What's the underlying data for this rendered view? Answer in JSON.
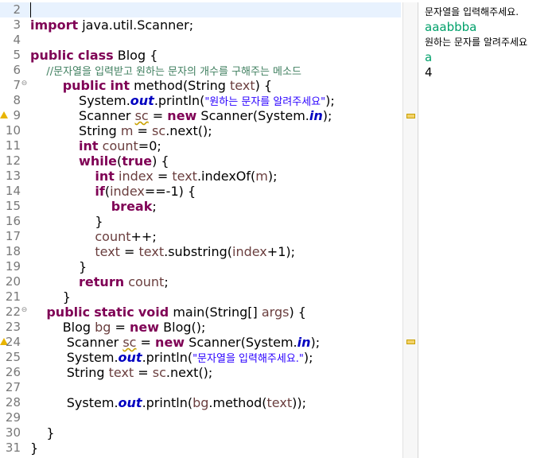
{
  "editor": {
    "lines": [
      {
        "n": "2",
        "parts": [],
        "current": true
      },
      {
        "n": "3",
        "parts": [
          [
            "kw",
            "import"
          ],
          [
            "t",
            " java.util.Scanner;"
          ]
        ]
      },
      {
        "n": "4",
        "parts": []
      },
      {
        "n": "5",
        "parts": [
          [
            "kw",
            "public"
          ],
          [
            "t",
            " "
          ],
          [
            "kw",
            "class"
          ],
          [
            "t",
            " Blog {"
          ]
        ]
      },
      {
        "n": "6",
        "parts": [
          [
            "t",
            "    "
          ],
          [
            "cm",
            "//문자열을 입력받고 원하는 문자의 개수를 구해주는 메소드"
          ]
        ]
      },
      {
        "n": "7",
        "fold": "⊖",
        "parts": [
          [
            "t",
            "        "
          ],
          [
            "kw",
            "public"
          ],
          [
            "t",
            " "
          ],
          [
            "kw",
            "int"
          ],
          [
            "t",
            " method(String "
          ],
          [
            "var",
            "text"
          ],
          [
            "t",
            ") {"
          ]
        ]
      },
      {
        "n": "8",
        "parts": [
          [
            "t",
            "            System."
          ],
          [
            "fld",
            "out"
          ],
          [
            "t",
            ".println("
          ],
          [
            "st",
            "\"원하는 문자를 알려주세요\""
          ],
          [
            "t",
            ");"
          ]
        ]
      },
      {
        "n": "9",
        "warn": true,
        "parts": [
          [
            "t",
            "            Scanner "
          ],
          [
            "varw",
            "sc"
          ],
          [
            "t",
            " = "
          ],
          [
            "kw",
            "new"
          ],
          [
            "t",
            " Scanner(System."
          ],
          [
            "fld",
            "in"
          ],
          [
            "t",
            ");"
          ]
        ]
      },
      {
        "n": "10",
        "parts": [
          [
            "t",
            "            String "
          ],
          [
            "var",
            "m"
          ],
          [
            "t",
            " = "
          ],
          [
            "var",
            "sc"
          ],
          [
            "t",
            ".next();"
          ]
        ]
      },
      {
        "n": "11",
        "parts": [
          [
            "t",
            "            "
          ],
          [
            "kw",
            "int"
          ],
          [
            "t",
            " "
          ],
          [
            "var",
            "count"
          ],
          [
            "t",
            "=0;"
          ]
        ]
      },
      {
        "n": "12",
        "parts": [
          [
            "t",
            "            "
          ],
          [
            "kw",
            "while"
          ],
          [
            "t",
            "("
          ],
          [
            "kw",
            "true"
          ],
          [
            "t",
            ") {"
          ]
        ]
      },
      {
        "n": "13",
        "parts": [
          [
            "t",
            "                "
          ],
          [
            "kw",
            "int"
          ],
          [
            "t",
            " "
          ],
          [
            "var",
            "index"
          ],
          [
            "t",
            " = "
          ],
          [
            "var",
            "text"
          ],
          [
            "t",
            ".indexOf("
          ],
          [
            "var",
            "m"
          ],
          [
            "t",
            ");"
          ]
        ]
      },
      {
        "n": "14",
        "parts": [
          [
            "t",
            "                "
          ],
          [
            "kw",
            "if"
          ],
          [
            "t",
            "("
          ],
          [
            "var",
            "index"
          ],
          [
            "t",
            "==-1) {"
          ]
        ]
      },
      {
        "n": "15",
        "parts": [
          [
            "t",
            "                    "
          ],
          [
            "kw",
            "break"
          ],
          [
            "t",
            ";"
          ]
        ]
      },
      {
        "n": "16",
        "parts": [
          [
            "t",
            "                }"
          ]
        ]
      },
      {
        "n": "17",
        "parts": [
          [
            "t",
            "                "
          ],
          [
            "var",
            "count"
          ],
          [
            "t",
            "++;"
          ]
        ]
      },
      {
        "n": "18",
        "parts": [
          [
            "t",
            "                "
          ],
          [
            "var",
            "text"
          ],
          [
            "t",
            " = "
          ],
          [
            "var",
            "text"
          ],
          [
            "t",
            ".substring("
          ],
          [
            "var",
            "index"
          ],
          [
            "t",
            "+1);"
          ]
        ]
      },
      {
        "n": "19",
        "parts": [
          [
            "t",
            "            }"
          ]
        ]
      },
      {
        "n": "20",
        "parts": [
          [
            "t",
            "            "
          ],
          [
            "kw",
            "return"
          ],
          [
            "t",
            " "
          ],
          [
            "var",
            "count"
          ],
          [
            "t",
            ";"
          ]
        ]
      },
      {
        "n": "21",
        "parts": [
          [
            "t",
            "        }"
          ]
        ]
      },
      {
        "n": "22",
        "fold": "⊖",
        "parts": [
          [
            "t",
            "    "
          ],
          [
            "kw",
            "public"
          ],
          [
            "t",
            " "
          ],
          [
            "kw",
            "static"
          ],
          [
            "t",
            " "
          ],
          [
            "kw",
            "void"
          ],
          [
            "t",
            " main(String[] "
          ],
          [
            "var",
            "args"
          ],
          [
            "t",
            ") {"
          ]
        ]
      },
      {
        "n": "23",
        "parts": [
          [
            "t",
            "        Blog "
          ],
          [
            "var",
            "bg"
          ],
          [
            "t",
            " = "
          ],
          [
            "kw",
            "new"
          ],
          [
            "t",
            " Blog();"
          ]
        ]
      },
      {
        "n": "24",
        "warn": true,
        "parts": [
          [
            "t",
            "         Scanner "
          ],
          [
            "varw",
            "sc"
          ],
          [
            "t",
            " = "
          ],
          [
            "kw",
            "new"
          ],
          [
            "t",
            " Scanner(System."
          ],
          [
            "fld",
            "in"
          ],
          [
            "t",
            ");"
          ]
        ]
      },
      {
        "n": "25",
        "parts": [
          [
            "t",
            "         System."
          ],
          [
            "fld",
            "out"
          ],
          [
            "t",
            ".println("
          ],
          [
            "st",
            "\"문자열을 입력해주세요.\""
          ],
          [
            "t",
            ");"
          ]
        ]
      },
      {
        "n": "26",
        "parts": [
          [
            "t",
            "         String "
          ],
          [
            "var",
            "text"
          ],
          [
            "t",
            " = "
          ],
          [
            "var",
            "sc"
          ],
          [
            "t",
            ".next();"
          ]
        ]
      },
      {
        "n": "27",
        "parts": []
      },
      {
        "n": "28",
        "parts": [
          [
            "t",
            "         System."
          ],
          [
            "fld",
            "out"
          ],
          [
            "t",
            ".println("
          ],
          [
            "var",
            "bg"
          ],
          [
            "t",
            ".method("
          ],
          [
            "var",
            "text"
          ],
          [
            "t",
            "));"
          ]
        ]
      },
      {
        "n": "29",
        "parts": []
      },
      {
        "n": "30",
        "parts": [
          [
            "t",
            "    }"
          ]
        ]
      },
      {
        "n": "31",
        "parts": [
          [
            "t",
            "}"
          ]
        ]
      }
    ]
  },
  "console": {
    "lines": [
      {
        "kind": "out",
        "text": "문자열을 입력해주세요."
      },
      {
        "kind": "in",
        "text": "aaabbba"
      },
      {
        "kind": "out",
        "text": "원하는 문자를 알려주세요"
      },
      {
        "kind": "in",
        "text": "a"
      },
      {
        "kind": "num",
        "text": "4"
      }
    ]
  },
  "colors": {
    "keyword": "#7f0055",
    "string": "#2a00ff",
    "comment": "#3f7f5f",
    "static_field": "#0000c0",
    "local_var": "#6a3e3e",
    "console_input": "#00a06a",
    "current_line": "#e8f2fe",
    "warning": "#e8b400"
  }
}
